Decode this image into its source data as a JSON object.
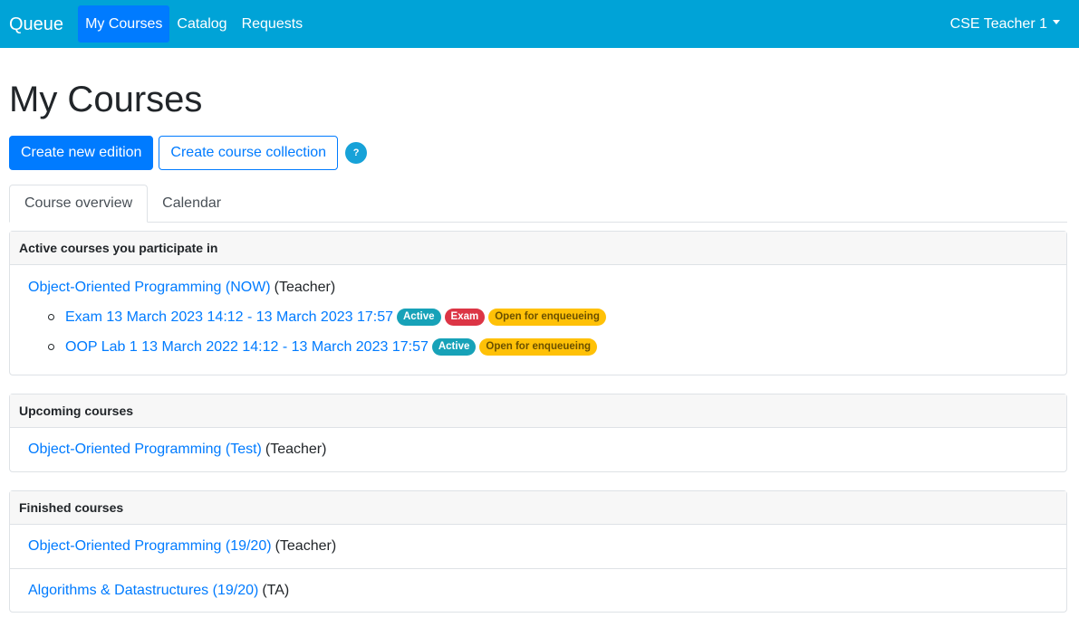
{
  "navbar": {
    "brand": "Queue",
    "links": [
      "My Courses",
      "Catalog",
      "Requests"
    ],
    "user": "CSE Teacher 1"
  },
  "page_title": "My Courses",
  "actions": {
    "create_edition": "Create new edition",
    "create_collection": "Create course collection",
    "help": "?"
  },
  "tabs": [
    "Course overview",
    "Calendar"
  ],
  "active": {
    "header": "Active courses you participate in",
    "course": {
      "name": "Object-Oriented Programming (NOW)",
      "role": "(Teacher)"
    },
    "labs": [
      {
        "name": "Exam 13 March 2023 14:12 - 13 March 2023 17:57",
        "badges": [
          "Active",
          "Exam",
          "Open for enqueueing"
        ]
      },
      {
        "name": "OOP Lab 1 13 March 2022 14:12 - 13 March 2023 17:57",
        "badges": [
          "Active",
          "Open for enqueueing"
        ]
      }
    ]
  },
  "upcoming": {
    "header": "Upcoming courses",
    "courses": [
      {
        "name": "Object-Oriented Programming (Test)",
        "role": "(Teacher)"
      }
    ]
  },
  "finished": {
    "header": "Finished courses",
    "courses": [
      {
        "name": "Object-Oriented Programming (19/20)",
        "role": "(Teacher)"
      },
      {
        "name": "Algorithms & Datastructures (19/20)",
        "role": "(TA)"
      }
    ]
  },
  "colors": {
    "navbar": "#00a3d7",
    "primary": "#007bff",
    "info": "#17a2b8",
    "danger": "#dc3545",
    "warning": "#ffc107"
  }
}
